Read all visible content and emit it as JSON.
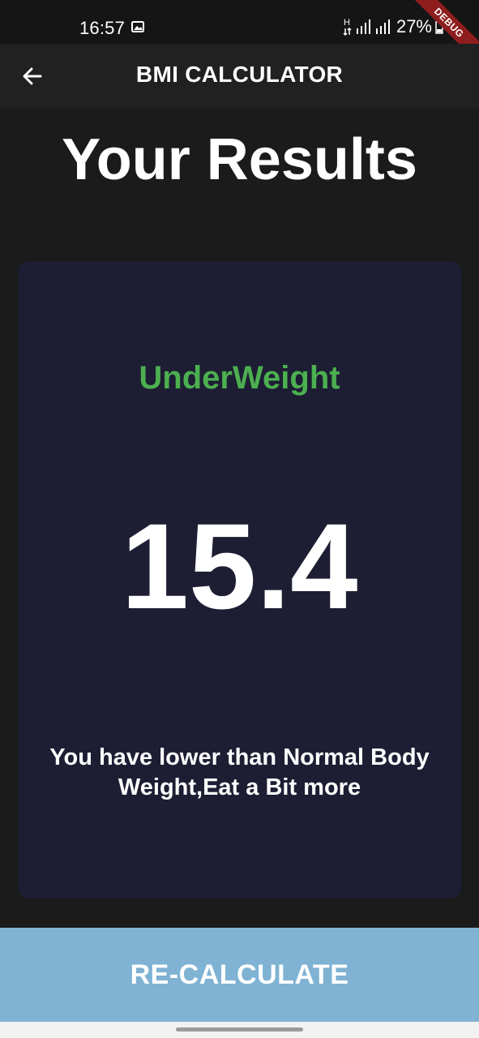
{
  "status_bar": {
    "time": "16:57",
    "battery": "27%",
    "gallery_icon": "image-icon",
    "network_icon": "hplus-icon",
    "signal_icons": [
      "signal-icon",
      "signal-icon"
    ],
    "debug_label": "DEBUG"
  },
  "app_bar": {
    "title": "BMI CALCULATOR",
    "back_icon": "arrow-left-icon"
  },
  "results": {
    "heading": "Your Results",
    "category": "UnderWeight",
    "bmi": "15.4",
    "advice": "You have lower than Normal Body Weight,Eat a Bit more"
  },
  "action": {
    "label": "RE-CALCULATE"
  },
  "colors": {
    "background": "#1b1b1b",
    "app_bar": "#212121",
    "card": "#1d1e33",
    "underweight": "#4caf50",
    "button": "#7fb2d3",
    "debug_ribbon": "#8e1d1d"
  }
}
